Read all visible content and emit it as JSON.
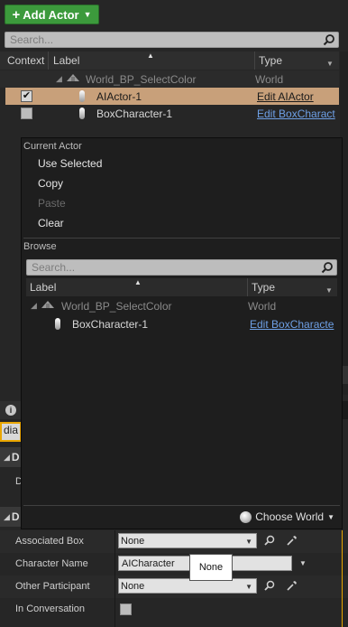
{
  "toolbar": {
    "add_actor_label": "Add Actor"
  },
  "outliner": {
    "search_placeholder": "Search...",
    "columns": {
      "context": "Context",
      "label": "Label",
      "type": "Type"
    },
    "rows": [
      {
        "label": "World_BP_SelectColor",
        "type": "World",
        "checked": null
      },
      {
        "label": "AIActor-1",
        "type": "Edit AIActor",
        "checked": true
      },
      {
        "label": "BoxCharacter-1",
        "type": "Edit BoxCharact",
        "checked": false
      }
    ]
  },
  "menu": {
    "current_actor_heading": "Current Actor",
    "items": [
      "Use Selected",
      "Copy",
      "Paste",
      "Clear"
    ],
    "browse_heading": "Browse",
    "browse_search_placeholder": "Search...",
    "columns": {
      "label": "Label",
      "type": "Type"
    },
    "rows": [
      {
        "label": "World_BP_SelectColor",
        "type": "World"
      },
      {
        "label": "BoxCharacter-1",
        "type": "Edit BoxCharacte"
      }
    ],
    "choose_world_label": "Choose World"
  },
  "details": {
    "filter_value": "dia",
    "section1_label": "D",
    "row_first_label": "D",
    "section2_label": "D",
    "props": [
      {
        "label": "Associated Box",
        "value": "None"
      },
      {
        "label": "Character Name",
        "value": "AICharacter"
      },
      {
        "label": "Other Participant",
        "value": "None"
      },
      {
        "label": "In Conversation",
        "value": ""
      }
    ],
    "tooltip": "None"
  },
  "colors": {
    "accent_green": "#3c9a3c",
    "selection": "#c8a07a",
    "link": "#6ea0e6",
    "focus_border": "#e9a600"
  }
}
